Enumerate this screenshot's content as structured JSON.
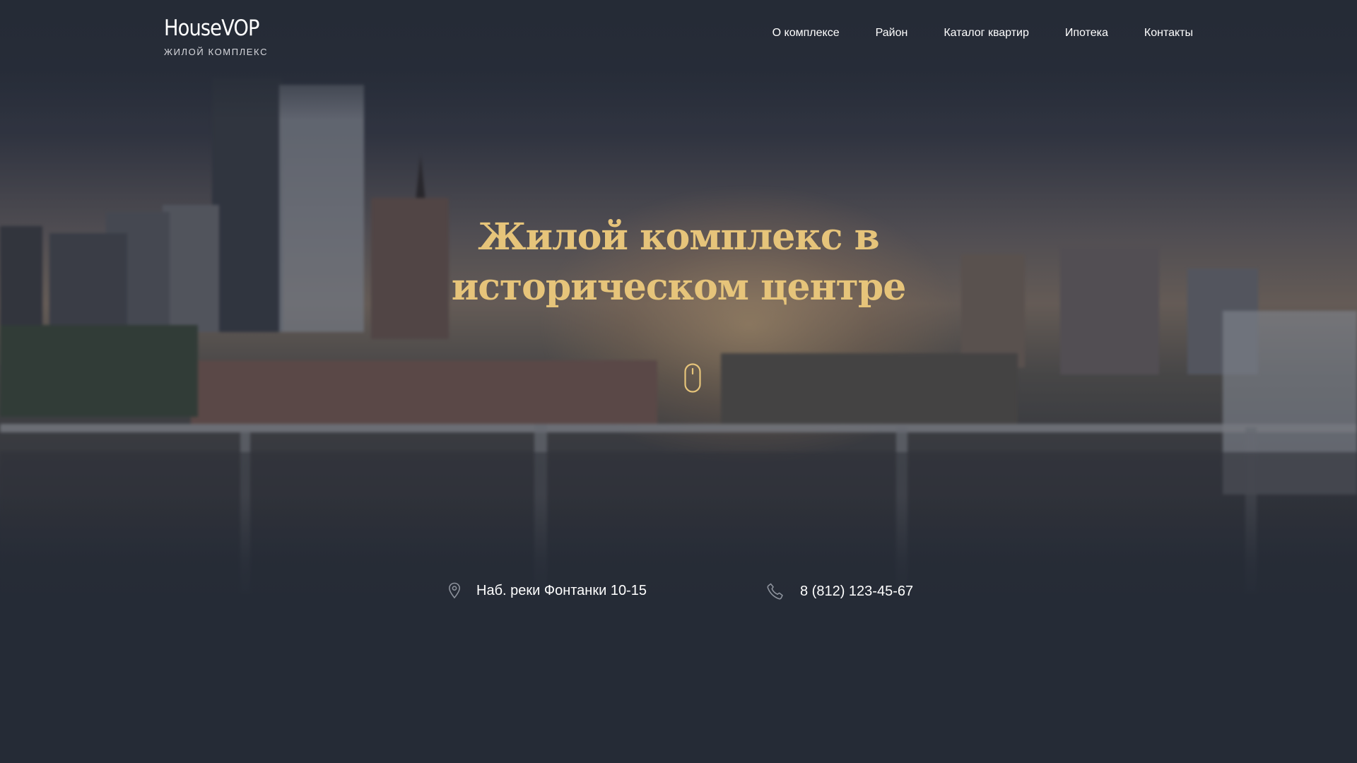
{
  "brand": {
    "name": "HouseVOP",
    "tagline": "ЖИЛОЙ КОМПЛЕКС"
  },
  "nav": {
    "items": [
      {
        "label": "О комплексе"
      },
      {
        "label": "Район"
      },
      {
        "label": "Каталог квартир"
      },
      {
        "label": "Ипотека"
      },
      {
        "label": "Контакты"
      }
    ]
  },
  "hero": {
    "title_line1": "Жилой комплекс в",
    "title_line2": "историческом центре",
    "scroll_icon": "mouse-icon"
  },
  "contacts": {
    "address": "Наб. реки Фонтанки 10-15",
    "address_icon": "map-pin-icon",
    "phone": "8 (812) 123-45-67",
    "phone_icon": "phone-icon"
  },
  "colors": {
    "background": "#252b36",
    "accent_gold": "#e6c47a",
    "text": "#ffffff"
  }
}
